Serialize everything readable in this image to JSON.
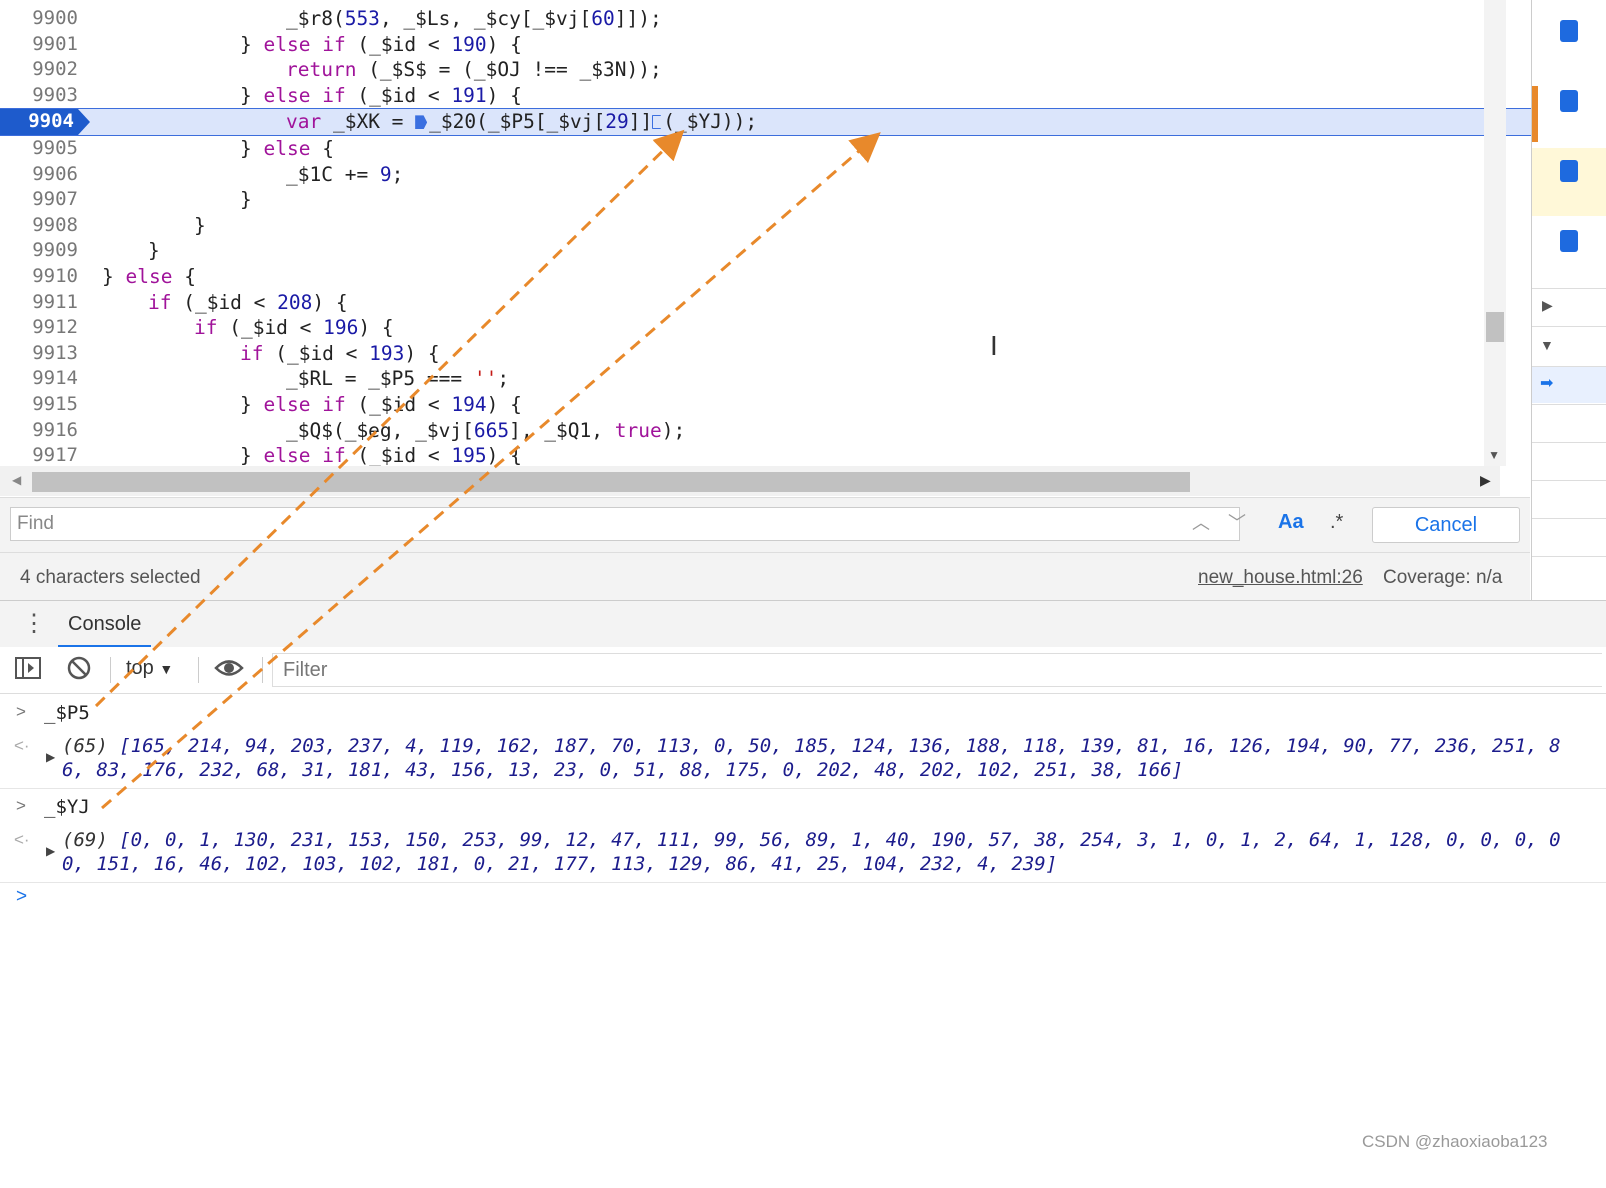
{
  "editor": {
    "lines": [
      {
        "n": "9900",
        "indent": "        ",
        "html": "_$r8(<span class=\"num\">553</span>, _$Ls, _$cy[_$vj[<span class=\"num\">60</span>]]);"
      },
      {
        "n": "9901",
        "indent": "      ",
        "html": "} <span class=\"kw\">else</span> <span class=\"kw\">if</span> (_$id &lt; <span class=\"num\">190</span>) {"
      },
      {
        "n": "9902",
        "indent": "        ",
        "html": "<span class=\"kw\">return</span> (_$S$ = (_$OJ !== _$3N));"
      },
      {
        "n": "9903",
        "indent": "      ",
        "html": "} <span class=\"kw\">else</span> <span class=\"kw\">if</span> (_$id &lt; <span class=\"num\">191</span>) {"
      },
      {
        "n": "9904",
        "indent": "        ",
        "active": true,
        "html": "<span class=\"kw\">var</span> _$XK = <span class=\"bp\"></span>_$20(_$P5[_$vj[<span class=\"num\">29</span>]]<span class=\"bp hollow\"></span>(_$YJ));"
      },
      {
        "n": "9905",
        "indent": "      ",
        "html": "} <span class=\"kw\">else</span> {"
      },
      {
        "n": "9906",
        "indent": "        ",
        "html": "_$1C += <span class=\"num\">9</span>;"
      },
      {
        "n": "9907",
        "indent": "      ",
        "html": "}"
      },
      {
        "n": "9908",
        "indent": "    ",
        "html": "}"
      },
      {
        "n": "9909",
        "indent": "  ",
        "html": "}"
      },
      {
        "n": "9910",
        "indent": "",
        "html": "} <span class=\"kw\">else</span> {"
      },
      {
        "n": "9911",
        "indent": "  ",
        "html": "<span class=\"kw\">if</span> (_$id &lt; <span class=\"num\">208</span>) {"
      },
      {
        "n": "9912",
        "indent": "    ",
        "html": "<span class=\"kw\">if</span> (_$id &lt; <span class=\"num\">196</span>) {"
      },
      {
        "n": "9913",
        "indent": "      ",
        "html": "<span class=\"kw\">if</span> (_$id &lt; <span class=\"num\">193</span>) {"
      },
      {
        "n": "9914",
        "indent": "        ",
        "html": "_$RL = _$P5 === <span class=\"str\">''</span>;"
      },
      {
        "n": "9915",
        "indent": "      ",
        "html": "} <span class=\"kw\">else</span> <span class=\"kw\">if</span> (_$id &lt; <span class=\"num\">194</span>) {"
      },
      {
        "n": "9916",
        "indent": "        ",
        "html": "_$Q$(_$eg, _$vj[<span class=\"num\">665</span>], _$Q1, <span class=\"kw\">true</span>);"
      },
      {
        "n": "9917",
        "indent": "      ",
        "html": "} <span class=\"kw\">else</span> <span class=\"kw\">if</span> (_$id &lt; <span class=\"num\">195</span>) {"
      }
    ]
  },
  "find": {
    "placeholder": "Find",
    "case_label": "Aa",
    "regex_label": ".*",
    "cancel_label": "Cancel"
  },
  "status": {
    "selection": "4 characters selected",
    "file": "new_house.html:26",
    "coverage": "Coverage: n/a"
  },
  "console": {
    "tab_label": "Console",
    "context": "top",
    "filter_placeholder": "Filter",
    "entries": [
      {
        "input": "_$P5",
        "length": "(65)",
        "line1": "[165, 214, 94, 203, 237, 4, 119, 162, 187, 70, 113, 0, 50, 185, 124, 136, 188, 118, 139, 81, 16, 126, 194, 90, 77, 236, 251, 8",
        "line2": "6, 83, 176, 232, 68, 31, 181, 43, 156, 13, 23, 0, 51, 88, 175, 0, 202, 48, 202, 102, 251, 38, 166]"
      },
      {
        "input": "_$YJ",
        "length": "(69)",
        "line1": "[0, 0, 1, 130, 231, 153, 150, 253, 99, 12, 47, 111, 99, 56, 89, 1, 40, 190, 57, 38, 254, 3, 1, 0, 1, 2, 64, 1, 128, 0, 0, 0, 0",
        "line2": "0, 151, 16, 46, 102, 103, 102, 181, 0, 21, 177, 113, 129, 86, 41, 25, 104, 232, 4, 239]"
      }
    ]
  },
  "watermark": "CSDN @zhaoxiaoba123",
  "colors": {
    "accent": "#1a73e8",
    "arrow": "#e8892b",
    "active_line": "#dbe5fb"
  }
}
